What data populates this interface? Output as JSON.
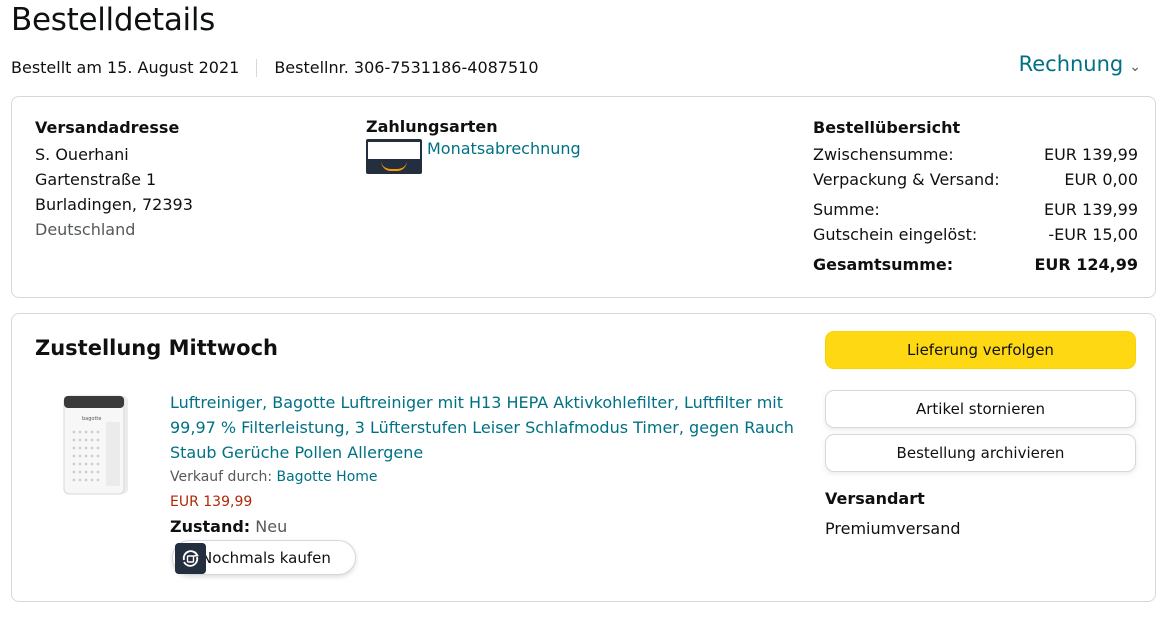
{
  "page": {
    "title": "Bestelldetails"
  },
  "meta": {
    "ordered": "Bestellt am 15. August 2021",
    "order_number": "Bestellnr. 306-7531186-4087510"
  },
  "invoice": {
    "label": "Rechnung"
  },
  "address": {
    "heading": "Versandadresse",
    "name": "S. Ouerhani",
    "street": "Gartenstraße 1",
    "city": "Burladingen, 72393",
    "country": "Deutschland"
  },
  "payment": {
    "heading": "Zahlungsarten",
    "method": "Monatsabrechnung"
  },
  "summary": {
    "heading": "Bestellübersicht",
    "rows": [
      {
        "label": "Zwischensumme:",
        "value": "EUR 139,99"
      },
      {
        "label": "Verpackung & Versand:",
        "value": "EUR 0,00"
      },
      {
        "label": "Summe:",
        "value": "EUR 139,99"
      },
      {
        "label": "Gutschein eingelöst:",
        "value": "-EUR 15,00"
      }
    ],
    "total_label": "Gesamtsumme:",
    "total_value": "EUR 124,99"
  },
  "delivery": {
    "heading": "Zustellung Mittwoch"
  },
  "product": {
    "title": "Luftreiniger, Bagotte Luftreiniger mit H13 HEPA Aktivkohlefilter, Luftfilter mit 99,97 % Filterleistung, 3 Lüfterstufen Leiser Schlafmodus Timer, gegen Rauch Staub Gerüche Pollen Allergene",
    "sold_by_label": "Verkauf durch:",
    "seller": "Bagotte Home",
    "price": "EUR 139,99",
    "condition_label": "Zustand:",
    "condition": "Neu",
    "buy_again": "Nochmals kaufen"
  },
  "actions": {
    "track": "Lieferung verfolgen",
    "cancel": "Artikel stornieren",
    "archive": "Bestellung archivieren"
  },
  "shipping": {
    "heading": "Versandart",
    "method": "Premiumversand"
  },
  "colors": {
    "link": "#007185",
    "price": "#b12704",
    "track_button": "#ffd814"
  }
}
